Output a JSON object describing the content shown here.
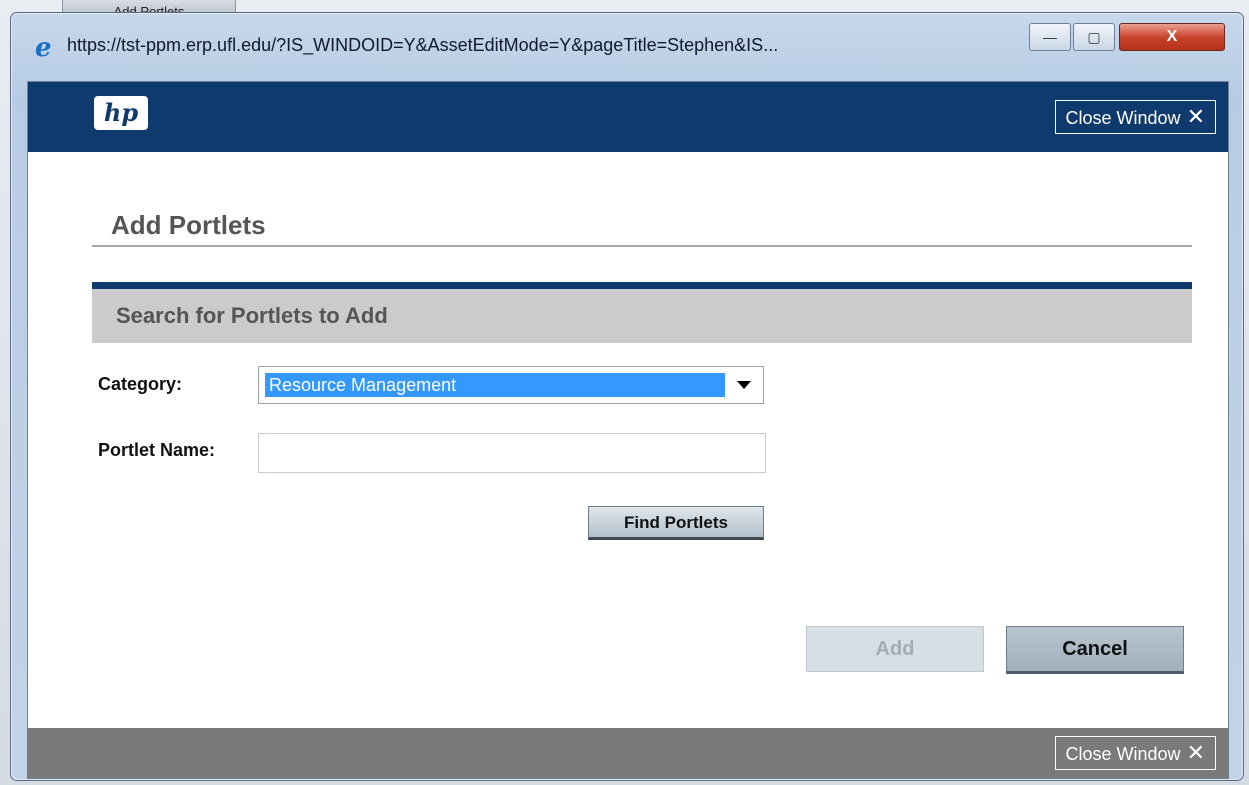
{
  "background": {
    "tab_label": "Add Portlets"
  },
  "window": {
    "title": "https://tst-ppm.erp.ufl.edu/?IS_WINDOID=Y&AssetEditMode=Y&pageTitle=Stephen&IS...",
    "minimize_glyph": "—",
    "maximize_glyph": "▢",
    "close_glyph": "X"
  },
  "header": {
    "logo_text": "hp",
    "close_window_label": "Close Window",
    "close_window_icon": "✕"
  },
  "page": {
    "title": "Add Portlets"
  },
  "search": {
    "section_title": "Search for Portlets to Add",
    "category_label": "Category:",
    "category_value": "Resource Management",
    "portlet_name_label": "Portlet Name:",
    "portlet_name_value": "",
    "find_button": "Find Portlets"
  },
  "actions": {
    "add_button": "Add",
    "cancel_button": "Cancel"
  },
  "footer": {
    "close_window_label": "Close Window",
    "close_window_icon": "✕"
  },
  "colors": {
    "header_blue": "#0f3a6d",
    "selection_blue": "#3399ff",
    "section_gray": "#cbcbcb",
    "footer_gray": "#7a7a7a"
  }
}
